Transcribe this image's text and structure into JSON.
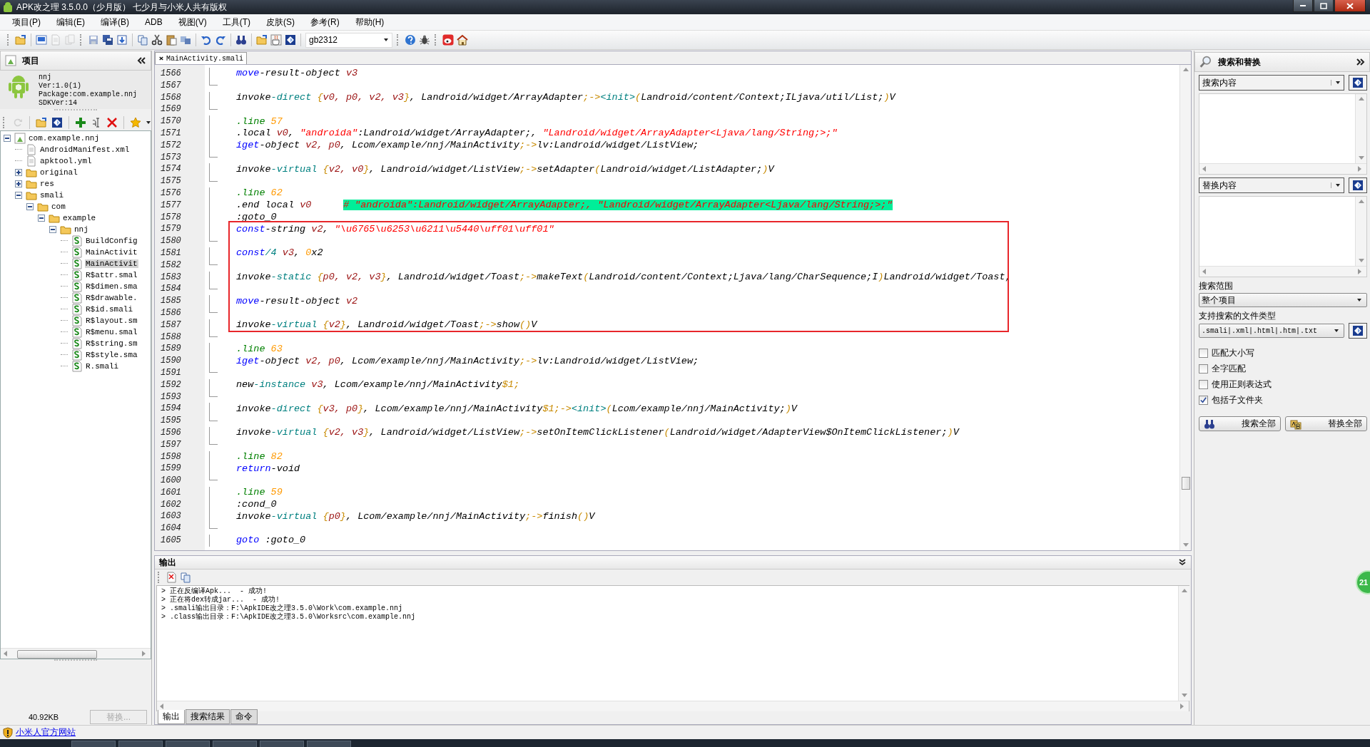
{
  "window": {
    "title": "APK改之理 3.5.0.0（少月版） 七少月与小米人共有版权"
  },
  "menu": [
    {
      "label": "项目(P)"
    },
    {
      "label": "编辑(E)"
    },
    {
      "label": "编译(B)"
    },
    {
      "label": "ADB"
    },
    {
      "label": "视图(V)"
    },
    {
      "label": "工具(T)"
    },
    {
      "label": "皮肤(S)"
    },
    {
      "label": "参考(R)"
    },
    {
      "label": "帮助(H)"
    }
  ],
  "toolbar": {
    "encoding": "gb2312"
  },
  "project_panel": {
    "title": "项目",
    "info": [
      "nnj",
      "Ver:1.0(1)",
      "Package:com.example.nnj",
      "SDKVer:14"
    ],
    "tree": [
      {
        "label": "com.example.nnj",
        "kind": "project",
        "expanded": true,
        "selected": false,
        "children": [
          {
            "label": "AndroidManifest.xml",
            "kind": "file",
            "selected": false
          },
          {
            "label": "apktool.yml",
            "kind": "file",
            "selected": false
          },
          {
            "label": "original",
            "kind": "folder",
            "expanded": false,
            "selected": false
          },
          {
            "label": "res",
            "kind": "folder",
            "expanded": false,
            "selected": false
          },
          {
            "label": "smali",
            "kind": "folder",
            "expanded": true,
            "selected": false,
            "children": [
              {
                "label": "com",
                "kind": "folder",
                "expanded": true,
                "selected": false,
                "children": [
                  {
                    "label": "example",
                    "kind": "folder",
                    "expanded": true,
                    "selected": false,
                    "children": [
                      {
                        "label": "nnj",
                        "kind": "folder",
                        "expanded": true,
                        "selected": false,
                        "children": [
                          {
                            "label": "BuildConfig",
                            "kind": "smali",
                            "selected": false
                          },
                          {
                            "label": "MainActivit",
                            "kind": "smali",
                            "selected": false
                          },
                          {
                            "label": "MainActivit",
                            "kind": "smali",
                            "selected": true
                          },
                          {
                            "label": "R$attr.smal",
                            "kind": "smali",
                            "selected": false
                          },
                          {
                            "label": "R$dimen.sma",
                            "kind": "smali",
                            "selected": false
                          },
                          {
                            "label": "R$drawable.",
                            "kind": "smali",
                            "selected": false
                          },
                          {
                            "label": "R$id.smali",
                            "kind": "smali",
                            "selected": false
                          },
                          {
                            "label": "R$layout.sm",
                            "kind": "smali",
                            "selected": false
                          },
                          {
                            "label": "R$menu.smal",
                            "kind": "smali",
                            "selected": false
                          },
                          {
                            "label": "R$string.sm",
                            "kind": "smali",
                            "selected": false
                          },
                          {
                            "label": "R$style.sma",
                            "kind": "smali",
                            "selected": false
                          },
                          {
                            "label": "R.smali",
                            "kind": "smali",
                            "selected": false
                          }
                        ]
                      }
                    ]
                  }
                ]
              }
            ]
          }
        ]
      }
    ],
    "file_size": "40.92KB",
    "replace_button": {
      "label": "替换...",
      "disabled": true
    }
  },
  "editor": {
    "tab": "MainActivity.smali",
    "lines": [
      {
        "kind": "line",
        "number": "1566",
        "code": [
          {
            "text": "move",
            "kind": "op"
          },
          {
            "text": "-result-object ",
            "kind": "plain"
          },
          {
            "text": "v3",
            "kind": "reg"
          }
        ]
      },
      {
        "kind": "line",
        "number": "1567"
      },
      {
        "kind": "line",
        "number": "1568",
        "code": [
          {
            "text": "invoke",
            "kind": "plain"
          },
          {
            "text": "-direct ",
            "kind": "sub"
          },
          {
            "text": "{",
            "kind": "br"
          },
          {
            "text": "v0, p0, v2, v3",
            "kind": "reg"
          },
          {
            "text": "}",
            "kind": "br"
          },
          {
            "text": ", Landroid/widget/ArrayAdapter",
            "kind": "plain"
          },
          {
            "text": ";->",
            "kind": "br"
          },
          {
            "text": "<init>",
            "kind": "sub"
          },
          {
            "text": "(",
            "kind": "br"
          },
          {
            "text": "Landroid/content/Context;ILjava/util/List;",
            "kind": "plain"
          },
          {
            "text": ")",
            "kind": "br"
          },
          {
            "text": "V",
            "kind": "plain"
          }
        ]
      },
      {
        "kind": "line",
        "number": "1569"
      },
      {
        "kind": "line",
        "number": "1570",
        "code": [
          {
            "text": ".line ",
            "kind": "dir"
          },
          {
            "text": "57",
            "kind": "num"
          }
        ]
      },
      {
        "kind": "line",
        "number": "1571",
        "code": [
          {
            "text": ".local ",
            "kind": "plain"
          },
          {
            "text": "v0",
            "kind": "reg"
          },
          {
            "text": ", ",
            "kind": "plain"
          },
          {
            "text": "\"androida\"",
            "kind": "str"
          },
          {
            "text": ":Landroid/widget/ArrayAdapter;, ",
            "kind": "plain"
          },
          {
            "text": "\"Landroid/widget/ArrayAdapter<Ljava/lang/String;>;\"",
            "kind": "str"
          }
        ]
      },
      {
        "kind": "line",
        "number": "1572",
        "code": [
          {
            "text": "iget",
            "kind": "op"
          },
          {
            "text": "-object ",
            "kind": "plain"
          },
          {
            "text": "v2, p0",
            "kind": "reg"
          },
          {
            "text": ", Lcom/example/nnj/MainActivity",
            "kind": "plain"
          },
          {
            "text": ";->",
            "kind": "br"
          },
          {
            "text": "lv:Landroid/widget/ListView;",
            "kind": "plain"
          }
        ]
      },
      {
        "kind": "line",
        "number": "1573"
      },
      {
        "kind": "line",
        "number": "1574",
        "code": [
          {
            "text": "invoke",
            "kind": "plain"
          },
          {
            "text": "-virtual ",
            "kind": "sub"
          },
          {
            "text": "{",
            "kind": "br"
          },
          {
            "text": "v2, v0",
            "kind": "reg"
          },
          {
            "text": "}",
            "kind": "br"
          },
          {
            "text": ", Landroid/widget/ListView",
            "kind": "plain"
          },
          {
            "text": ";->",
            "kind": "br"
          },
          {
            "text": "setAdapter",
            "kind": "plain"
          },
          {
            "text": "(",
            "kind": "br"
          },
          {
            "text": "Landroid/widget/ListAdapter;",
            "kind": "plain"
          },
          {
            "text": ")",
            "kind": "br"
          },
          {
            "text": "V",
            "kind": "plain"
          }
        ]
      },
      {
        "kind": "line",
        "number": "1575"
      },
      {
        "kind": "line",
        "number": "1576",
        "code": [
          {
            "text": ".line ",
            "kind": "dir"
          },
          {
            "text": "62",
            "kind": "num"
          }
        ]
      },
      {
        "kind": "line",
        "number": "1577",
        "code": [
          {
            "text": ".end local ",
            "kind": "plain"
          },
          {
            "text": "v0",
            "kind": "reg"
          },
          {
            "text": "# \"androida\":Landroid/widget/ArrayAdapter;, \"Landroid/widget/ArrayAdapter<Ljava/lang/String;>;\"",
            "kind": "comment"
          }
        ]
      },
      {
        "kind": "line",
        "number": "1578",
        "code": [
          {
            "text": ":goto_0",
            "kind": "plain"
          }
        ]
      },
      {
        "kind": "highlight",
        "lines": [
          {
            "kind": "line",
            "number": "1579",
            "code": [
              {
                "text": "const",
                "kind": "op"
              },
              {
                "text": "-string ",
                "kind": "plain"
              },
              {
                "text": "v2",
                "kind": "reg"
              },
              {
                "text": ", ",
                "kind": "plain"
              },
              {
                "text": "\"\\u6765\\u6253\\u6211\\u5440\\uff01\\uff01\"",
                "kind": "str"
              }
            ]
          },
          {
            "kind": "line",
            "number": "1580"
          },
          {
            "kind": "line",
            "number": "1581",
            "code": [
              {
                "text": "const",
                "kind": "op"
              },
              {
                "text": "/4 ",
                "kind": "sub"
              },
              {
                "text": "v3",
                "kind": "reg"
              },
              {
                "text": ", ",
                "kind": "plain"
              },
              {
                "text": "0",
                "kind": "num"
              },
              {
                "text": "x2",
                "kind": "plain"
              }
            ]
          },
          {
            "kind": "line",
            "number": "1582"
          },
          {
            "kind": "line",
            "number": "1583",
            "code": [
              {
                "text": "invoke",
                "kind": "plain"
              },
              {
                "text": "-static ",
                "kind": "sub"
              },
              {
                "text": "{",
                "kind": "br"
              },
              {
                "text": "p0, v2, v3",
                "kind": "reg"
              },
              {
                "text": "}",
                "kind": "br"
              },
              {
                "text": ", Landroid/widget/Toast",
                "kind": "plain"
              },
              {
                "text": ";->",
                "kind": "br"
              },
              {
                "text": "makeText",
                "kind": "plain"
              },
              {
                "text": "(",
                "kind": "br"
              },
              {
                "text": "Landroid/content/Context;Ljava/lang/CharSequence;I",
                "kind": "plain"
              },
              {
                "text": ")",
                "kind": "br"
              },
              {
                "text": "Landroid/widget/Toast;",
                "kind": "plain"
              }
            ]
          },
          {
            "kind": "line",
            "number": "1584"
          },
          {
            "kind": "line",
            "number": "1585",
            "code": [
              {
                "text": "move",
                "kind": "op"
              },
              {
                "text": "-result-object ",
                "kind": "plain"
              },
              {
                "text": "v2",
                "kind": "reg"
              }
            ]
          },
          {
            "kind": "line",
            "number": "1586"
          },
          {
            "kind": "line",
            "number": "1587",
            "code": [
              {
                "text": "invoke",
                "kind": "plain"
              },
              {
                "text": "-virtual ",
                "kind": "sub"
              },
              {
                "text": "{",
                "kind": "br"
              },
              {
                "text": "v2",
                "kind": "reg"
              },
              {
                "text": "}",
                "kind": "br"
              },
              {
                "text": ", Landroid/widget/Toast",
                "kind": "plain"
              },
              {
                "text": ";->",
                "kind": "br"
              },
              {
                "text": "show",
                "kind": "plain"
              },
              {
                "text": "()",
                "kind": "br"
              },
              {
                "text": "V",
                "kind": "plain"
              }
            ]
          }
        ]
      },
      {
        "kind": "line",
        "number": "1588"
      },
      {
        "kind": "line",
        "number": "1589",
        "code": [
          {
            "text": ".line ",
            "kind": "dir"
          },
          {
            "text": "63",
            "kind": "num"
          }
        ]
      },
      {
        "kind": "line",
        "number": "1590",
        "code": [
          {
            "text": "iget",
            "kind": "op"
          },
          {
            "text": "-object ",
            "kind": "plain"
          },
          {
            "text": "v2, p0",
            "kind": "reg"
          },
          {
            "text": ", Lcom/example/nnj/MainActivity",
            "kind": "plain"
          },
          {
            "text": ";->",
            "kind": "br"
          },
          {
            "text": "lv:Landroid/widget/ListView;",
            "kind": "plain"
          }
        ]
      },
      {
        "kind": "line",
        "number": "1591"
      },
      {
        "kind": "line",
        "number": "1592",
        "code": [
          {
            "text": "new",
            "kind": "plain"
          },
          {
            "text": "-instance ",
            "kind": "sub"
          },
          {
            "text": "v3",
            "kind": "reg"
          },
          {
            "text": ", Lcom/example/nnj/MainActivity",
            "kind": "plain"
          },
          {
            "text": "$1;",
            "kind": "br"
          }
        ]
      },
      {
        "kind": "line",
        "number": "1593"
      },
      {
        "kind": "line",
        "number": "1594",
        "code": [
          {
            "text": "invoke",
            "kind": "plain"
          },
          {
            "text": "-direct ",
            "kind": "sub"
          },
          {
            "text": "{",
            "kind": "br"
          },
          {
            "text": "v3, p0",
            "kind": "reg"
          },
          {
            "text": "}",
            "kind": "br"
          },
          {
            "text": ", Lcom/example/nnj/MainActivity",
            "kind": "plain"
          },
          {
            "text": "$1;->",
            "kind": "br"
          },
          {
            "text": "<init>",
            "kind": "sub"
          },
          {
            "text": "(",
            "kind": "br"
          },
          {
            "text": "Lcom/example/nnj/MainActivity;",
            "kind": "plain"
          },
          {
            "text": ")",
            "kind": "br"
          },
          {
            "text": "V",
            "kind": "plain"
          }
        ]
      },
      {
        "kind": "line",
        "number": "1595"
      },
      {
        "kind": "line",
        "number": "1596",
        "code": [
          {
            "text": "invoke",
            "kind": "plain"
          },
          {
            "text": "-virtual ",
            "kind": "sub"
          },
          {
            "text": "{",
            "kind": "br"
          },
          {
            "text": "v2, v3",
            "kind": "reg"
          },
          {
            "text": "}",
            "kind": "br"
          },
          {
            "text": ", Landroid/widget/ListView",
            "kind": "plain"
          },
          {
            "text": ";->",
            "kind": "br"
          },
          {
            "text": "setOnItemClickListener",
            "kind": "plain"
          },
          {
            "text": "(",
            "kind": "br"
          },
          {
            "text": "Landroid/widget/AdapterView$OnItemClickListener;",
            "kind": "plain"
          },
          {
            "text": ")",
            "kind": "br"
          },
          {
            "text": "V",
            "kind": "plain"
          }
        ]
      },
      {
        "kind": "line",
        "number": "1597"
      },
      {
        "kind": "line",
        "number": "1598",
        "code": [
          {
            "text": ".line ",
            "kind": "dir"
          },
          {
            "text": "82",
            "kind": "num"
          }
        ]
      },
      {
        "kind": "line",
        "number": "1599",
        "code": [
          {
            "text": "return",
            "kind": "op"
          },
          {
            "text": "-void",
            "kind": "plain"
          }
        ]
      },
      {
        "kind": "line",
        "number": "1600"
      },
      {
        "kind": "line",
        "number": "1601",
        "code": [
          {
            "text": ".line ",
            "kind": "dir"
          },
          {
            "text": "59",
            "kind": "num"
          }
        ]
      },
      {
        "kind": "line",
        "number": "1602",
        "code": [
          {
            "text": ":cond_0",
            "kind": "plain"
          }
        ]
      },
      {
        "kind": "line",
        "number": "1603",
        "code": [
          {
            "text": "invoke",
            "kind": "plain"
          },
          {
            "text": "-virtual ",
            "kind": "sub"
          },
          {
            "text": "{",
            "kind": "br"
          },
          {
            "text": "p0",
            "kind": "reg"
          },
          {
            "text": "}",
            "kind": "br"
          },
          {
            "text": ", Lcom/example/nnj/MainActivity",
            "kind": "plain"
          },
          {
            "text": ";->",
            "kind": "br"
          },
          {
            "text": "finish",
            "kind": "plain"
          },
          {
            "text": "()",
            "kind": "br"
          },
          {
            "text": "V",
            "kind": "plain"
          }
        ]
      },
      {
        "kind": "line",
        "number": "1604"
      },
      {
        "kind": "line",
        "number": "1605",
        "code": [
          {
            "text": "goto",
            "kind": "op"
          },
          {
            "text": " :goto_0",
            "kind": "plain"
          }
        ]
      }
    ]
  },
  "output": {
    "title": "输出",
    "lines": [
      "> 正在反编译Apk...  - 成功!",
      "> 正在将dex转成jar...  - 成功!",
      "> .smali输出目录：F:\\ApkIDE改之理3.5.0\\Work\\com.example.nnj",
      "> .class输出目录：F:\\ApkIDE改之理3.5.0\\Worksrc\\com.example.nnj"
    ],
    "tabs": [
      {
        "label": "输出",
        "selected": true
      },
      {
        "label": "搜索结果",
        "selected": false
      },
      {
        "label": "命令",
        "selected": false
      }
    ]
  },
  "search_panel": {
    "title": "搜索和替换",
    "search_combo": {
      "value": "搜索内容"
    },
    "replace_combo": {
      "value": "替换内容"
    },
    "scope_label": "搜索范围",
    "scope": {
      "value": "整个项目"
    },
    "types_label": "支持搜索的文件类型",
    "types": {
      "value": ".smali|.xml|.html|.htm|.txt"
    },
    "options": [
      {
        "label": "匹配大小写",
        "checked": false
      },
      {
        "label": "全字匹配",
        "checked": false
      },
      {
        "label": "使用正则表达式",
        "checked": false
      },
      {
        "label": "包括子文件夹",
        "checked": true
      }
    ],
    "buttons": [
      {
        "label": "搜索全部",
        "kind": "search"
      },
      {
        "label": "替换全部",
        "kind": "replace"
      }
    ]
  },
  "status_bar": {
    "link": "小米人官方网站"
  },
  "floating_badge": "21"
}
